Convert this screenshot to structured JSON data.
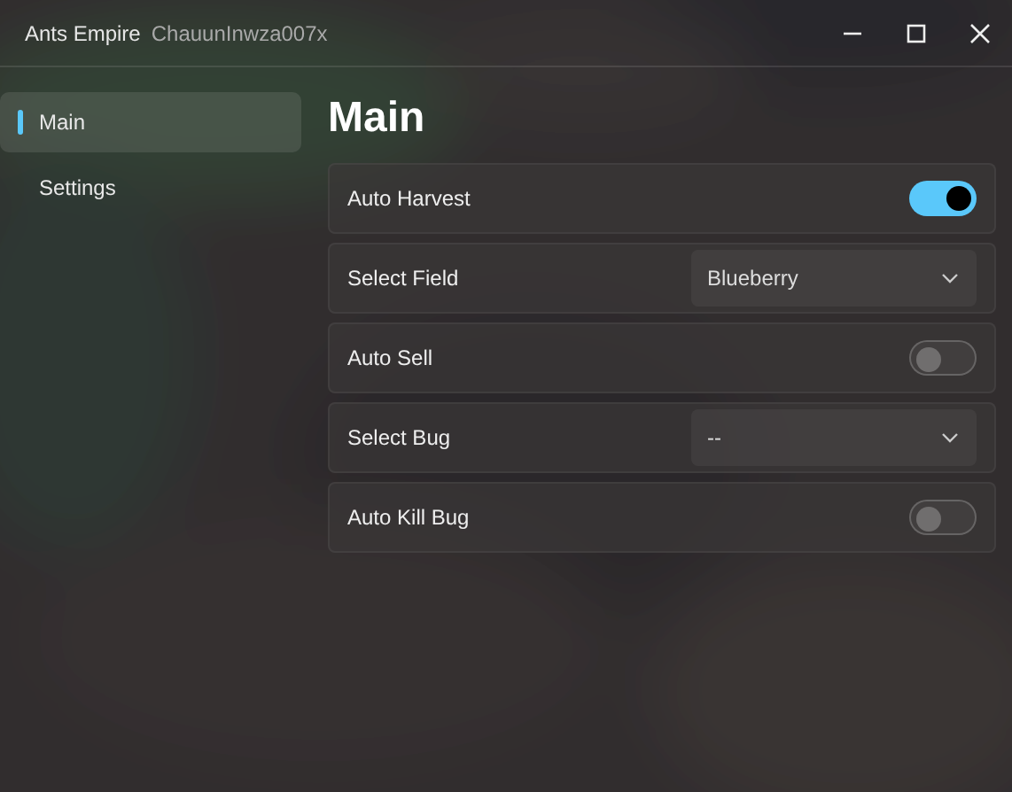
{
  "window": {
    "title": "Ants Empire",
    "subtitle": "ChauunInwza007x"
  },
  "sidebar": {
    "items": [
      {
        "label": "Main",
        "selected": true
      },
      {
        "label": "Settings",
        "selected": false
      }
    ]
  },
  "page": {
    "heading": "Main",
    "options": [
      {
        "kind": "toggle",
        "label": "Auto Harvest",
        "on": true
      },
      {
        "kind": "dropdown",
        "label": "Select Field",
        "value": "Blueberry"
      },
      {
        "kind": "toggle",
        "label": "Auto Sell",
        "on": false
      },
      {
        "kind": "dropdown",
        "label": "Select Bug",
        "value": "--"
      },
      {
        "kind": "toggle",
        "label": "Auto Kill Bug",
        "on": false
      }
    ]
  }
}
